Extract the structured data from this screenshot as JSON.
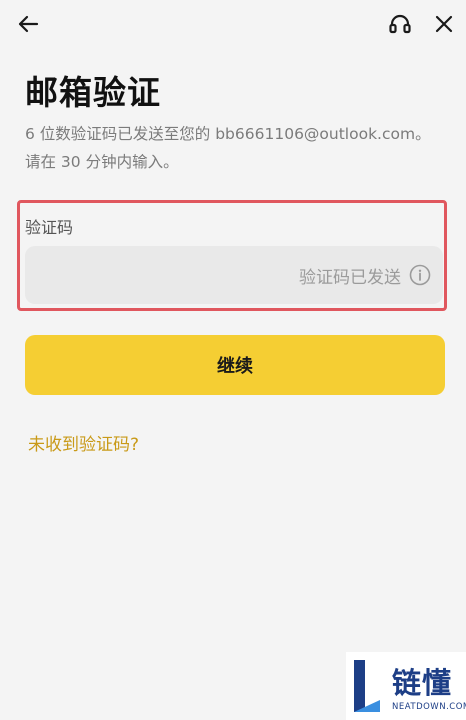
{
  "header": {
    "back_icon": "arrow-left-icon",
    "support_icon": "headset-icon",
    "close_icon": "close-icon"
  },
  "page": {
    "title": "邮箱验证",
    "subtitle_line1": "6 位数验证码已发送至您的 bb6661106@outlook.com。",
    "subtitle_line2": "请在 30 分钟内输入。"
  },
  "verification": {
    "label": "验证码",
    "value": "",
    "status_text": "验证码已发送",
    "info_icon": "info-circle-icon"
  },
  "actions": {
    "continue_label": "继续",
    "resend_label": "未收到验证码?"
  },
  "watermark": {
    "brand": "链懂",
    "site": "NEATDOWN.COM"
  },
  "colors": {
    "background": "#f4f4f4",
    "accent": "#f5ce33",
    "link": "#c99a18",
    "highlight": "#e0575e",
    "field_background": "#e9e9e9"
  }
}
